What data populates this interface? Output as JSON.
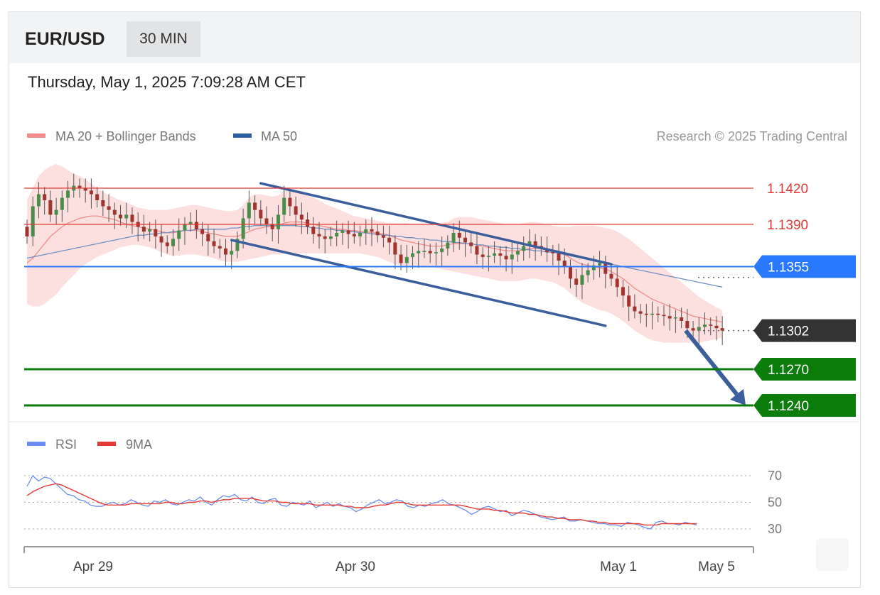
{
  "header": {
    "symbol": "EUR/USD",
    "timeframe": "30 MIN"
  },
  "timestamp": "Thursday, May 1, 2025 7:09:28 AM CET",
  "legend": {
    "ma20": "MA 20 + Bollinger Bands",
    "ma50": "MA 50"
  },
  "credit": "Research © 2025 Trading Central",
  "colors": {
    "ma20": "#f28b8b",
    "ma50": "#2e5fa3",
    "resistance": "#e53935",
    "pivot": "#2979ff",
    "support": "#0a7d0a",
    "last": "#333333",
    "rsi": "#6b8cf0",
    "rsi_ma": "#e53935"
  },
  "chart_data": [
    {
      "type": "candlestick",
      "title": "EUR/USD 30 MIN",
      "ylim": [
        1.1222,
        1.1452
      ],
      "x_ticks": [
        "Apr 29",
        "Apr 30",
        "May 1",
        "May 5"
      ],
      "levels": [
        {
          "label": "1.1420",
          "value": 1.142,
          "kind": "resistance"
        },
        {
          "label": "1.1390",
          "value": 1.139,
          "kind": "resistance"
        },
        {
          "label": "1.1355",
          "value": 1.1355,
          "kind": "pivot"
        },
        {
          "label": "1.1302",
          "value": 1.1302,
          "kind": "last"
        },
        {
          "label": "1.1270",
          "value": 1.127,
          "kind": "support"
        },
        {
          "label": "1.1240",
          "value": 1.124,
          "kind": "support"
        }
      ],
      "close_series": [
        1.138,
        1.1405,
        1.1415,
        1.141,
        1.1398,
        1.1402,
        1.1412,
        1.1418,
        1.1422,
        1.142,
        1.1418,
        1.1415,
        1.141,
        1.1405,
        1.1402,
        1.1398,
        1.1395,
        1.1398,
        1.1392,
        1.1388,
        1.1384,
        1.1386,
        1.138,
        1.1375,
        1.1372,
        1.1378,
        1.1385,
        1.139,
        1.1392,
        1.1386,
        1.1382,
        1.1376,
        1.1372,
        1.137,
        1.1365,
        1.1368,
        1.1378,
        1.1395,
        1.1408,
        1.1402,
        1.1395,
        1.139,
        1.1386,
        1.1398,
        1.1412,
        1.1405,
        1.1398,
        1.1394,
        1.1388,
        1.1382,
        1.138,
        1.1378,
        1.138,
        1.1383,
        1.1385,
        1.1382,
        1.138,
        1.1383,
        1.1386,
        1.1384,
        1.1381,
        1.1379,
        1.1375,
        1.1365,
        1.1358,
        1.1363,
        1.1366,
        1.1368,
        1.1368,
        1.1366,
        1.1367,
        1.137,
        1.1375,
        1.1383,
        1.1379,
        1.1375,
        1.1372,
        1.1365,
        1.1363,
        1.1364,
        1.1366,
        1.1364,
        1.1361,
        1.1365,
        1.1368,
        1.1372,
        1.1376,
        1.1372,
        1.137,
        1.1367,
        1.1366,
        1.136,
        1.1355,
        1.1345,
        1.134,
        1.1348,
        1.1352,
        1.1356,
        1.1358,
        1.1349,
        1.1345,
        1.1338,
        1.1331,
        1.1322,
        1.1318,
        1.1316,
        1.1315,
        1.1316,
        1.1315,
        1.1314,
        1.1312,
        1.1313,
        1.131,
        1.1304,
        1.1302,
        1.1305,
        1.1307,
        1.1306,
        1.1304,
        1.1302
      ],
      "ma20": [
        1.1358,
        1.1362,
        1.1368,
        1.1374,
        1.138,
        1.1384,
        1.1388,
        1.1391,
        1.1393,
        1.1395,
        1.1396,
        1.1397,
        1.1397,
        1.1396,
        1.1395,
        1.1394,
        1.1392,
        1.139,
        1.1389,
        1.1388,
        1.1387,
        1.1386,
        1.1385,
        1.1384,
        1.1383,
        1.1383,
        1.1384,
        1.1385,
        1.1385,
        1.1385,
        1.1384,
        1.1383,
        1.1382,
        1.1381,
        1.138,
        1.138,
        1.138,
        1.1382,
        1.1384,
        1.1386,
        1.1387,
        1.1388,
        1.1388,
        1.1389,
        1.1391,
        1.1392,
        1.1392,
        1.1392,
        1.1391,
        1.139,
        1.1389,
        1.1388,
        1.1387,
        1.1386,
        1.1386,
        1.1385,
        1.1385,
        1.1384,
        1.1384,
        1.1383,
        1.1383,
        1.1382,
        1.1381,
        1.1379,
        1.1377,
        1.1376,
        1.1375,
        1.1374,
        1.1373,
        1.1372,
        1.1372,
        1.1372,
        1.1373,
        1.1374,
        1.1374,
        1.1374,
        1.1374,
        1.1373,
        1.1372,
        1.1371,
        1.137,
        1.1369,
        1.1368,
        1.1368,
        1.1368,
        1.1369,
        1.137,
        1.137,
        1.137,
        1.1369,
        1.1368,
        1.1367,
        1.1365,
        1.1362,
        1.1359,
        1.1357,
        1.1356,
        1.1355,
        1.1354,
        1.1353,
        1.1351,
        1.1348,
        1.1345,
        1.1341,
        1.1337,
        1.1334,
        1.1331,
        1.1328,
        1.1326,
        1.1324,
        1.1322,
        1.132,
        1.1318,
        1.1316,
        1.1314,
        1.1313,
        1.1312,
        1.1311,
        1.131,
        1.1309
      ],
      "ma50": [
        1.1362,
        1.1363,
        1.1364,
        1.1365,
        1.1366,
        1.1367,
        1.1368,
        1.1369,
        1.137,
        1.1371,
        1.1372,
        1.1373,
        1.1374,
        1.1375,
        1.1376,
        1.1377,
        1.1378,
        1.1379,
        1.138,
        1.1381,
        1.1381,
        1.1382,
        1.1382,
        1.1383,
        1.1383,
        1.1384,
        1.1384,
        1.1385,
        1.1385,
        1.1386,
        1.1386,
        1.1386,
        1.1386,
        1.1386,
        1.1386,
        1.1387,
        1.1387,
        1.1388,
        1.1388,
        1.1389,
        1.1389,
        1.1389,
        1.1389,
        1.1389,
        1.1389,
        1.1389,
        1.1389,
        1.1388,
        1.1388,
        1.1387,
        1.1387,
        1.1386,
        1.1386,
        1.1385,
        1.1385,
        1.1384,
        1.1384,
        1.1383,
        1.1383,
        1.1382,
        1.1382,
        1.1381,
        1.1381,
        1.138,
        1.138,
        1.1379,
        1.1379,
        1.1378,
        1.1378,
        1.1377,
        1.1377,
        1.1376,
        1.1376,
        1.1375,
        1.1375,
        1.1374,
        1.1374,
        1.1373,
        1.1373,
        1.1372,
        1.1372,
        1.1371,
        1.1371,
        1.137,
        1.137,
        1.1369,
        1.1369,
        1.1368,
        1.1368,
        1.1367,
        1.1367,
        1.1366,
        1.1365,
        1.1364,
        1.1363,
        1.1362,
        1.1361,
        1.136,
        1.1359,
        1.1358,
        1.1357,
        1.1356,
        1.1355,
        1.1354,
        1.1353,
        1.1352,
        1.1351,
        1.135,
        1.1349,
        1.1348,
        1.1347,
        1.1346,
        1.1345,
        1.1344,
        1.1343,
        1.1342,
        1.1341,
        1.134,
        1.1339,
        1.1338
      ],
      "bb_upper": [
        1.141,
        1.142,
        1.143,
        1.1435,
        1.1438,
        1.144,
        1.1438,
        1.1435,
        1.1432,
        1.143,
        1.1427,
        1.1424,
        1.142,
        1.1417,
        1.1414,
        1.1412,
        1.141,
        1.1408,
        1.1406,
        1.1404,
        1.1403,
        1.1402,
        1.1402,
        1.1402,
        1.1402,
        1.1403,
        1.1404,
        1.1405,
        1.1406,
        1.1406,
        1.1405,
        1.1404,
        1.1403,
        1.1402,
        1.1401,
        1.1401,
        1.1402,
        1.1406,
        1.1412,
        1.1415,
        1.1415,
        1.1414,
        1.1413,
        1.1414,
        1.1418,
        1.1419,
        1.1418,
        1.1416,
        1.1414,
        1.1412,
        1.141,
        1.1407,
        1.1405,
        1.1403,
        1.1401,
        1.1399,
        1.1397,
        1.1396,
        1.1395,
        1.1394,
        1.1393,
        1.1392,
        1.1391,
        1.1391,
        1.1391,
        1.1391,
        1.139,
        1.139,
        1.139,
        1.139,
        1.139,
        1.1391,
        1.1392,
        1.1395,
        1.1396,
        1.1396,
        1.1396,
        1.1395,
        1.1394,
        1.1393,
        1.1392,
        1.1391,
        1.139,
        1.139,
        1.139,
        1.1391,
        1.1392,
        1.1392,
        1.1391,
        1.139,
        1.1389,
        1.1388,
        1.1388,
        1.1388,
        1.1389,
        1.1389,
        1.1389,
        1.1389,
        1.1388,
        1.1387,
        1.1386,
        1.1384,
        1.1381,
        1.1378,
        1.1374,
        1.137,
        1.1366,
        1.1362,
        1.1358,
        1.1354,
        1.135,
        1.1346,
        1.1342,
        1.1338,
        1.1334,
        1.133,
        1.1327,
        1.1324,
        1.1321,
        1.1319
      ],
      "bb_lower": [
        1.1324,
        1.1322,
        1.1322,
        1.1324,
        1.1328,
        1.1332,
        1.1338,
        1.1343,
        1.1348,
        1.1353,
        1.1357,
        1.136,
        1.1363,
        1.1365,
        1.1367,
        1.1369,
        1.1371,
        1.1372,
        1.1373,
        1.1373,
        1.1372,
        1.1371,
        1.1369,
        1.1367,
        1.1365,
        1.1364,
        1.1364,
        1.1365,
        1.1365,
        1.1365,
        1.1364,
        1.1363,
        1.1362,
        1.136,
        1.1359,
        1.1359,
        1.1359,
        1.136,
        1.1361,
        1.1362,
        1.1363,
        1.1364,
        1.1365,
        1.1365,
        1.1366,
        1.1366,
        1.1366,
        1.1366,
        1.1366,
        1.1366,
        1.1366,
        1.1366,
        1.1366,
        1.1366,
        1.1366,
        1.1366,
        1.1366,
        1.1366,
        1.1365,
        1.1364,
        1.1363,
        1.1361,
        1.1359,
        1.1357,
        1.1356,
        1.1355,
        1.1355,
        1.1355,
        1.1355,
        1.1355,
        1.1354,
        1.1353,
        1.1352,
        1.1351,
        1.135,
        1.1349,
        1.1348,
        1.1347,
        1.1346,
        1.1345,
        1.1344,
        1.1343,
        1.1343,
        1.1343,
        1.1343,
        1.1344,
        1.1345,
        1.1345,
        1.1344,
        1.1343,
        1.1342,
        1.134,
        1.1337,
        1.1333,
        1.1329,
        1.1325,
        1.1323,
        1.1321,
        1.1319,
        1.1318,
        1.1316,
        1.1313,
        1.131,
        1.1306,
        1.1302,
        1.1299,
        1.1296,
        1.1294,
        1.1293,
        1.1292,
        1.1292,
        1.1292,
        1.1292,
        1.1292,
        1.1292,
        1.1292,
        1.1293,
        1.1294,
        1.1295,
        1.1296
      ],
      "trendlines": [
        {
          "from": [
            40,
            1.1424
          ],
          "to": [
            100,
            1.1357
          ]
        },
        {
          "from": [
            35,
            1.1377
          ],
          "to": [
            99,
            1.1306
          ]
        }
      ],
      "forecast_arrow": {
        "from": [
          112,
          1.1302
        ],
        "to": [
          123,
          1.124
        ]
      }
    },
    {
      "type": "line",
      "title": "RSI",
      "series": [
        {
          "name": "RSI",
          "values": [
            62,
            70,
            66,
            69,
            68,
            64,
            60,
            56,
            55,
            52,
            51,
            48,
            47,
            47,
            49,
            50,
            48,
            49,
            52,
            50,
            48,
            47,
            51,
            50,
            52,
            49,
            48,
            50,
            52,
            51,
            54,
            50,
            48,
            52,
            55,
            54,
            56,
            52,
            51,
            54,
            50,
            49,
            52,
            53,
            48,
            47,
            50,
            49,
            48,
            51,
            46,
            48,
            50,
            47,
            49,
            47,
            46,
            43,
            45,
            48,
            50,
            52,
            49,
            50,
            52,
            51,
            47,
            46,
            48,
            47,
            49,
            50,
            52,
            49,
            48,
            46,
            44,
            41,
            43,
            46,
            47,
            45,
            43,
            44,
            40,
            42,
            44,
            43,
            41,
            39,
            38,
            37,
            38,
            39,
            36,
            36,
            37,
            36,
            35,
            34,
            34,
            33,
            33,
            32,
            35,
            34,
            33,
            31,
            30,
            35,
            36,
            34,
            34,
            33,
            35,
            34,
            33
          ]
        },
        {
          "name": "9MA",
          "values": [
            55,
            58,
            60,
            62,
            63,
            64,
            63,
            61,
            59,
            57,
            55,
            53,
            51,
            49,
            48,
            48,
            48,
            48,
            49,
            49,
            49,
            49,
            49,
            49,
            50,
            50,
            49,
            49,
            50,
            50,
            51,
            51,
            50,
            51,
            52,
            52,
            53,
            53,
            53,
            53,
            52,
            51,
            51,
            51,
            50,
            50,
            49,
            49,
            49,
            49,
            48,
            48,
            48,
            48,
            48,
            47,
            47,
            46,
            46,
            46,
            47,
            48,
            48,
            49,
            50,
            50,
            49,
            48,
            48,
            48,
            48,
            48,
            48,
            48,
            48,
            48,
            47,
            46,
            45,
            45,
            45,
            44,
            44,
            43,
            42,
            42,
            42,
            41,
            41,
            40,
            39,
            39,
            38,
            38,
            37,
            37,
            37,
            36,
            36,
            35,
            35,
            34,
            34,
            34,
            34,
            34,
            34,
            33,
            33,
            33,
            34,
            34,
            34,
            34,
            34,
            34,
            34
          ]
        }
      ],
      "ticks": [
        "70",
        "50",
        "30"
      ],
      "ylim": [
        20,
        80
      ]
    }
  ]
}
